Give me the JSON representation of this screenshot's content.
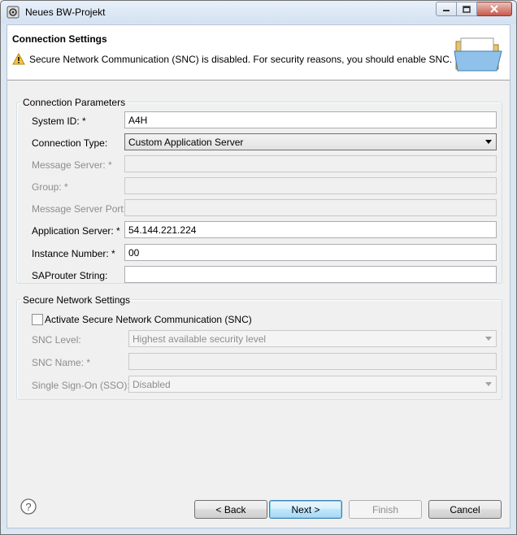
{
  "window": {
    "title": "Neues BW-Projekt",
    "icon": "eclipse-gear-icon",
    "buttons": [
      "minimize",
      "maximize",
      "close"
    ]
  },
  "header": {
    "title": "Connection Settings",
    "warning": "Secure Network Communication (SNC) is disabled. For security reasons, you should enable SNC.",
    "icon": "folder-icon"
  },
  "connection_parameters": {
    "group_label": "Connection Parameters",
    "system_id": {
      "label": "System ID: *",
      "value": "A4H"
    },
    "connection_type": {
      "label": "Connection Type:",
      "value": "Custom Application Server"
    },
    "message_server": {
      "label": "Message Server: *",
      "value": ""
    },
    "group": {
      "label": "Group: *",
      "value": ""
    },
    "message_server_port": {
      "label": "Message Server Port:",
      "value": ""
    },
    "application_server": {
      "label": "Application Server: *",
      "value": "54.144.221.224"
    },
    "instance_number": {
      "label": "Instance Number: *",
      "value": "00"
    },
    "saprouter_string": {
      "label": "SAProuter String:",
      "value": ""
    }
  },
  "secure_network": {
    "group_label": "Secure Network Settings",
    "activate_snc": {
      "label": "Activate Secure Network Communication (SNC)",
      "checked": false
    },
    "snc_level": {
      "label": "SNC Level:",
      "value": "Highest available security level"
    },
    "snc_name": {
      "label": "SNC Name: *",
      "value": ""
    },
    "sso": {
      "label": "Single Sign-On (SSO):",
      "value": "Disabled"
    }
  },
  "footer": {
    "back": "< Back",
    "next": "Next >",
    "finish": "Finish",
    "cancel": "Cancel",
    "help_icon": "help-icon"
  },
  "colors": {
    "title_bar": "#dbe6f3",
    "close_button": "#c8594b",
    "default_button_border": "#3c7fb1"
  }
}
